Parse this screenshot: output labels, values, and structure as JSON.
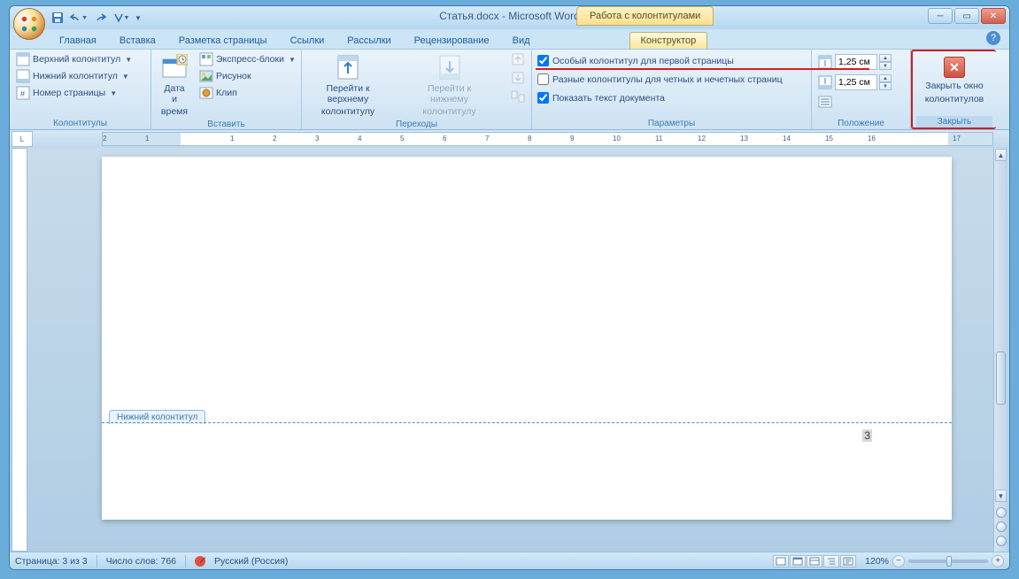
{
  "window": {
    "title": "Статья.docx - Microsoft Word",
    "context_title": "Работа с колонтитулами"
  },
  "tabs": {
    "home": "Главная",
    "insert": "Вставка",
    "layout": "Разметка страницы",
    "refs": "Ссылки",
    "mail": "Рассылки",
    "review": "Рецензирование",
    "view": "Вид",
    "designer": "Конструктор"
  },
  "ribbon": {
    "g_hf": {
      "label": "Колонтитулы",
      "top_header": "Верхний колонтитул",
      "bottom_header": "Нижний колонтитул",
      "page_num": "Номер страницы"
    },
    "g_insert": {
      "label": "Вставить",
      "datetime_l1": "Дата и",
      "datetime_l2": "время",
      "express": "Экспресс-блоки",
      "picture": "Рисунок",
      "clip": "Клип"
    },
    "g_nav": {
      "label": "Переходы",
      "goto_top_l1": "Перейти к верхнему",
      "goto_top_l2": "колонтитулу",
      "goto_bottom_l1": "Перейти к нижнему",
      "goto_bottom_l2": "колонтитулу"
    },
    "g_opts": {
      "label": "Параметры",
      "first_page": "Особый колонтитул для первой страницы",
      "odd_even": "Разные колонтитулы для четных и нечетных страниц",
      "show_doc": "Показать текст документа"
    },
    "g_pos": {
      "label": "Положение",
      "val1": "1,25 см",
      "val2": "1,25 см"
    },
    "g_close": {
      "label": "Закрыть",
      "l1": "Закрыть окно",
      "l2": "колонтитулов"
    }
  },
  "document": {
    "footer_tab": "Нижний колонтитул",
    "page_number_value": "3"
  },
  "statusbar": {
    "page": "Страница: 3 из 3",
    "words": "Число слов: 766",
    "lang": "Русский (Россия)",
    "zoom": "120%"
  },
  "ruler_numbers": [
    "2",
    "1",
    "",
    "1",
    "2",
    "3",
    "4",
    "5",
    "6",
    "7",
    "8",
    "9",
    "10",
    "11",
    "12",
    "13",
    "14",
    "15",
    "16",
    "",
    "17"
  ]
}
